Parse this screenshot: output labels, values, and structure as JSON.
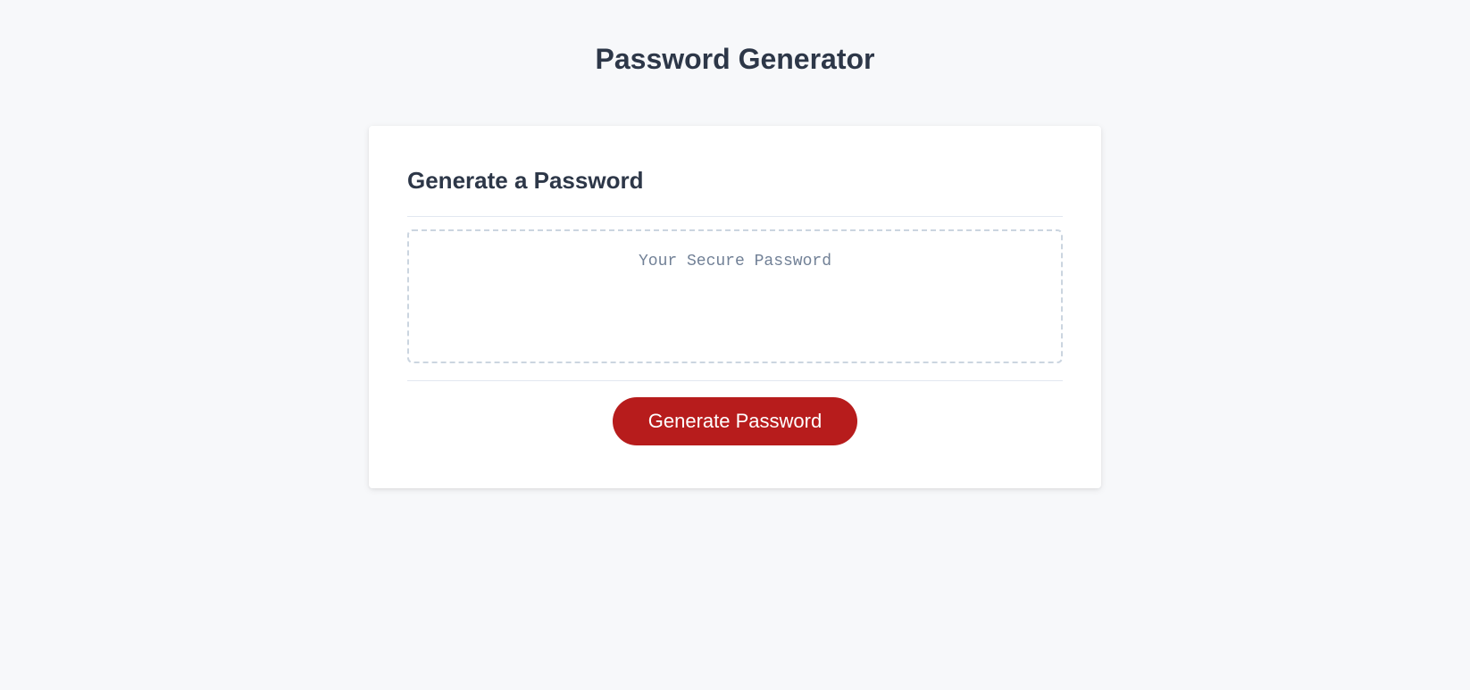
{
  "header": {
    "title": "Password Generator"
  },
  "card": {
    "heading": "Generate a Password",
    "output": {
      "placeholder": "Your Secure Password",
      "value": ""
    },
    "button_label": "Generate Password"
  }
}
